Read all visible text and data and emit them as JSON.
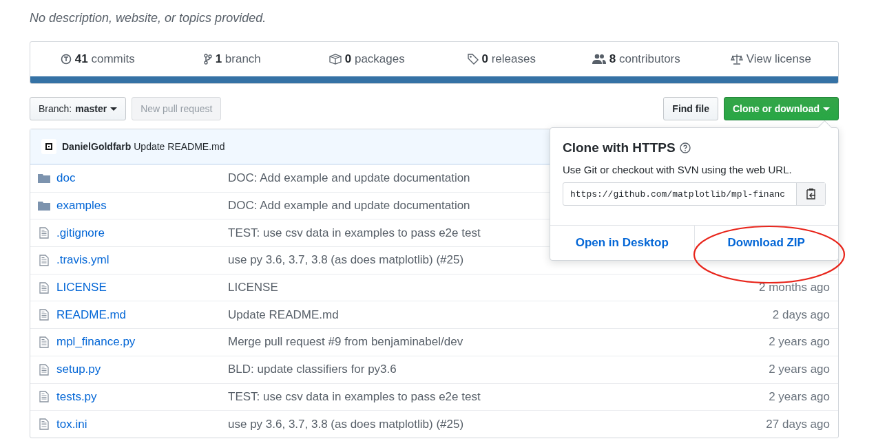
{
  "description": "No description, website, or topics provided.",
  "stats": [
    {
      "kind": "commits",
      "count": "41",
      "label": "commits"
    },
    {
      "kind": "branch",
      "count": "1",
      "label": "branch"
    },
    {
      "kind": "packages",
      "count": "0",
      "label": "packages"
    },
    {
      "kind": "releases",
      "count": "0",
      "label": "releases"
    },
    {
      "kind": "contributors",
      "count": "8",
      "label": "contributors"
    },
    {
      "kind": "license",
      "label": "View license"
    }
  ],
  "branch_button": {
    "prefix": "Branch:",
    "name": "master"
  },
  "pull_request_button": {
    "label": "New pull request",
    "disabled": true
  },
  "find_file_button": {
    "label": "Find file"
  },
  "clone_button": {
    "label": "Clone or download"
  },
  "latest_commit": {
    "author": "DanielGoldfarb",
    "message": "Update README.md"
  },
  "files": [
    {
      "kind": "folder",
      "name": "doc",
      "message": "DOC: Add example and update documentation"
    },
    {
      "kind": "folder",
      "name": "examples",
      "message": "DOC: Add example and update documentation"
    },
    {
      "kind": "file",
      "name": ".gitignore",
      "message": "TEST: use csv data in examples to pass e2e test"
    },
    {
      "kind": "file",
      "name": ".travis.yml",
      "message": "use py 3.6, 3.7, 3.8 (as does matplotlib) (#25)"
    },
    {
      "kind": "file",
      "name": "LICENSE",
      "message": "LICENSE",
      "age": "2 months ago"
    },
    {
      "kind": "file",
      "name": "README.md",
      "message": "Update README.md",
      "age": "2 days ago"
    },
    {
      "kind": "file",
      "name": "mpl_finance.py",
      "message": "Merge pull request #9 from benjaminabel/dev",
      "age": "2 years ago"
    },
    {
      "kind": "file",
      "name": "setup.py",
      "message": "BLD: update classifiers for py3.6",
      "age": "2 years ago"
    },
    {
      "kind": "file",
      "name": "tests.py",
      "message": "TEST: use csv data in examples to pass e2e test",
      "age": "2 years ago"
    },
    {
      "kind": "file",
      "name": "tox.ini",
      "message": "use py 3.6, 3.7, 3.8 (as does matplotlib) (#25)",
      "age": "27 days ago"
    }
  ],
  "clone_popup": {
    "title": "Clone with HTTPS",
    "help": "Use Git or checkout with SVN using the web URL.",
    "url": "https://github.com/matplotlib/mpl-financ",
    "actions": [
      "Open in Desktop",
      "Download ZIP"
    ]
  }
}
